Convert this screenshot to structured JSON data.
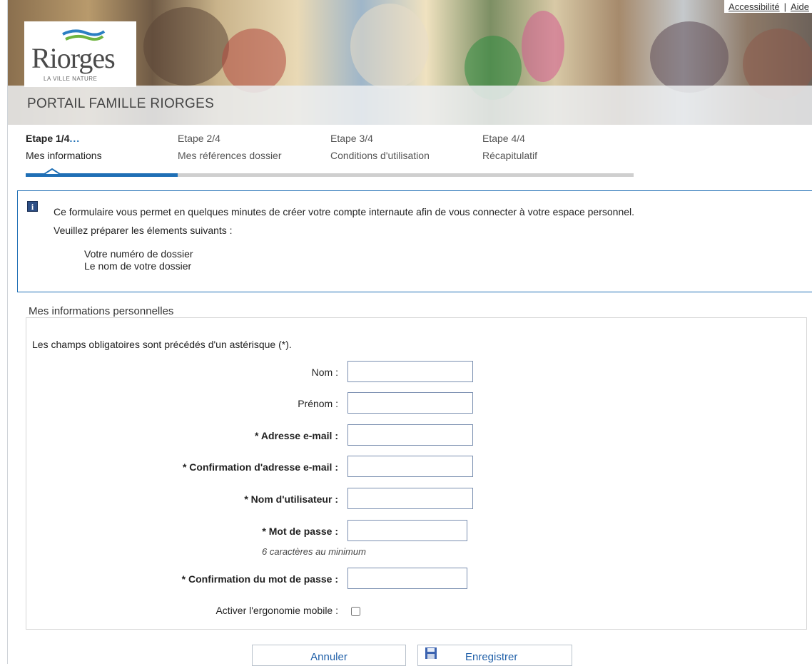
{
  "header": {
    "top_links": [
      "Accessibilité",
      "Aide"
    ],
    "top_links_separator": "|",
    "logo": {
      "name": "Riorges",
      "tagline": "LA VILLE NATURE"
    },
    "portal_title": "PORTAIL FAMILLE RIORGES"
  },
  "steps": {
    "current_index": 0,
    "progress_fraction": 0.25,
    "items": [
      {
        "number": "Etape 1/4",
        "suffix": "...",
        "label": "Mes informations"
      },
      {
        "number": "Etape 2/4",
        "label": "Mes références dossier"
      },
      {
        "number": "Etape 3/4",
        "label": "Conditions d'utilisation"
      },
      {
        "number": "Etape 4/4",
        "label": "Récapitulatif"
      }
    ]
  },
  "info": {
    "icon": "info-icon",
    "line1": "Ce formulaire vous permet en quelques minutes de créer votre compte internaute afin de vous connecter à votre espace personnel.",
    "line2": "Veuillez préparer les élements suivants :",
    "list": [
      "Votre numéro de dossier",
      "Le nom de votre dossier"
    ]
  },
  "form": {
    "legend": "Mes informations personnelles",
    "required_note": "Les champs obligatoires sont précédés d'un astérisque (*).",
    "fields": {
      "nom": {
        "label": "Nom :",
        "value": ""
      },
      "prenom": {
        "label": "Prénom :",
        "value": ""
      },
      "email": {
        "label": "* Adresse e-mail :",
        "value": ""
      },
      "email_confirm": {
        "label": "* Confirmation d'adresse e-mail :",
        "value": ""
      },
      "username": {
        "label": "* Nom d'utilisateur :",
        "value": ""
      },
      "password": {
        "label": "* Mot de passe :",
        "value": "",
        "hint": "6 caractères au minimum"
      },
      "password_confirm": {
        "label": "* Confirmation du mot de passe :",
        "value": ""
      }
    },
    "mobile": {
      "label": "Activer l'ergonomie mobile :",
      "checked": false
    }
  },
  "buttons": {
    "cancel": "Annuler",
    "save": "Enregistrer",
    "save_icon": "floppy-disk-icon"
  },
  "colors": {
    "accent": "#1f6fb5",
    "link": "#1f5fa8",
    "progress_track": "#cfcfcf"
  }
}
